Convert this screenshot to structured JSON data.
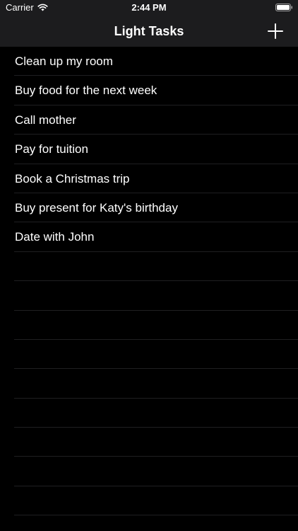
{
  "status_bar": {
    "carrier": "Carrier",
    "time": "2:44 PM",
    "wifi_icon": "wifi-icon",
    "battery_icon": "battery-icon"
  },
  "nav": {
    "title": "Light Tasks",
    "add_icon": "plus-icon"
  },
  "tasks": [
    "Clean up my room",
    "Buy food for the next week",
    "Call mother",
    "Pay for tuition",
    "Book a Christmas trip",
    "Buy present for Katy's birthday",
    "Date with John"
  ],
  "colors": {
    "background": "#000000",
    "bar_background": "#1c1c1e",
    "separator": "#1f1f21",
    "text": "#ffffff"
  }
}
